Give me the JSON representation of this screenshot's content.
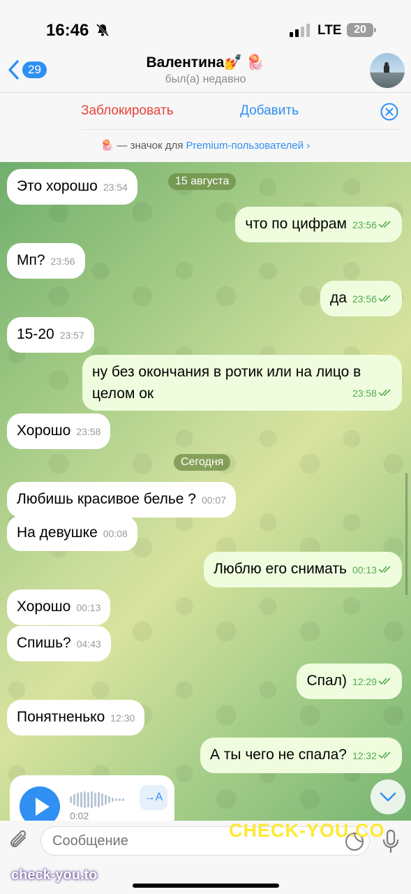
{
  "status": {
    "time": "16:46",
    "network": "LTE",
    "battery": "20"
  },
  "header": {
    "back_count": "29",
    "title": "Валентина💅 🪼",
    "subtitle": "был(а) недавно"
  },
  "actions": {
    "block": "Заблокировать",
    "add": "Добавить"
  },
  "premium": {
    "prefix": "🪼 — значок для ",
    "link": "Premium-пользователей ›"
  },
  "dates": {
    "aug": "15 августа",
    "today": "Сегодня"
  },
  "messages": [
    {
      "dir": "in",
      "text": "Это хорошо",
      "time": "23:54"
    },
    {
      "dir": "out",
      "text": "что по цифрам",
      "time": "23:56"
    },
    {
      "dir": "in",
      "text": "Мп?",
      "time": "23:56"
    },
    {
      "dir": "out",
      "text": "да",
      "time": "23:56"
    },
    {
      "dir": "in",
      "text": "15-20",
      "time": "23:57"
    },
    {
      "dir": "out",
      "text": "ну без окончания в ротик или на лицо в",
      "text2": "целом ок",
      "time": "23:58"
    },
    {
      "dir": "in",
      "text": "Хорошо",
      "time": "23:58"
    },
    {
      "dir": "in",
      "text": "Любишь красивое белье ?",
      "time": "00:07"
    },
    {
      "dir": "in",
      "text": "На девушке",
      "time": "00:08"
    },
    {
      "dir": "out",
      "text": "Люблю его снимать",
      "time": "00:13"
    },
    {
      "dir": "in",
      "text": "Хорошо",
      "time": "00:13"
    },
    {
      "dir": "in",
      "text": "Спишь?",
      "time": "04:43"
    },
    {
      "dir": "out",
      "text": "Спал)",
      "time": "12:29"
    },
    {
      "dir": "in",
      "text": "Понятненько",
      "time": "12:30"
    },
    {
      "dir": "out",
      "text": "А ты чего не спала?",
      "time": "12:32"
    }
  ],
  "voice": {
    "duration": "0:02",
    "transcribe": "→A"
  },
  "input": {
    "placeholder": "Сообщение"
  },
  "watermarks": {
    "main": "CHECK-YOU.CO",
    "corner": "check-you.to"
  },
  "colors": {
    "accent": "#2f8ff2",
    "danger": "#e5433b",
    "outgoing": "#effdde",
    "watermark": "#ffe833"
  }
}
